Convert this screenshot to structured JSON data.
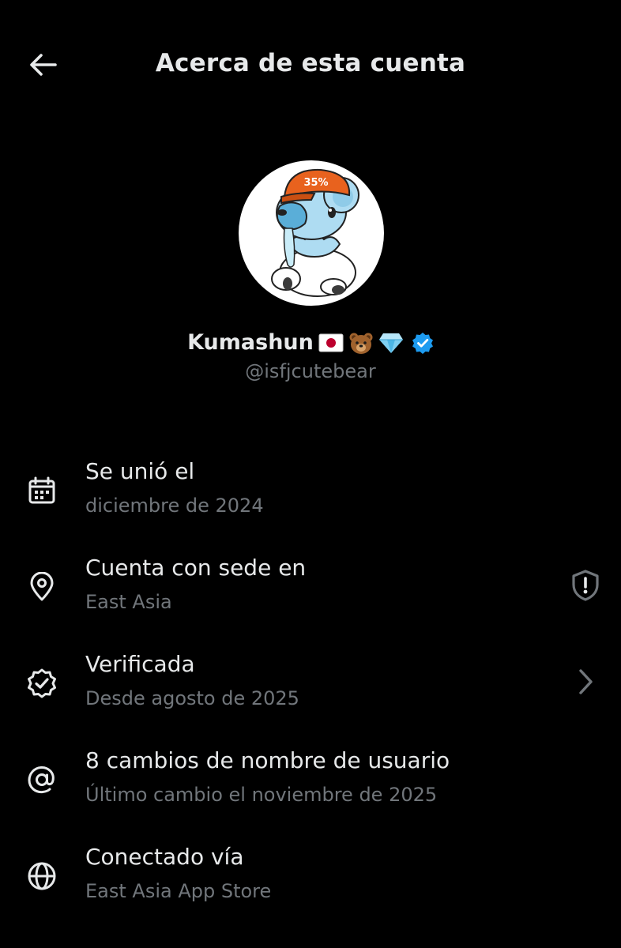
{
  "header": {
    "title": "Acerca de esta cuenta",
    "back_icon": "arrow-left-icon"
  },
  "profile": {
    "display_name": "Kumashun",
    "name_emojis": [
      "🇯🇵",
      "🐻",
      "💎"
    ],
    "handle": "@isfjcutebear",
    "verified": true,
    "avatar_cap_text": "35%",
    "colors": {
      "verified_badge": "#1d9bf0",
      "text_primary": "#e7e9ea",
      "text_secondary": "#71767b",
      "background": "#000000"
    }
  },
  "info": [
    {
      "icon": "calendar-icon",
      "title": "Se unió el",
      "subtitle": "diciembre de 2024",
      "trailing": null
    },
    {
      "icon": "location-pin-icon",
      "title": "Cuenta con sede en",
      "subtitle": "East Asia",
      "trailing": "shield-alert-icon"
    },
    {
      "icon": "verified-badge-icon",
      "title": "Verificada",
      "subtitle": "Desde agosto de 2025",
      "trailing": "chevron-right-icon"
    },
    {
      "icon": "at-sign-icon",
      "title": "8 cambios de nombre de usuario",
      "subtitle": "Último cambio el noviembre de 2025",
      "trailing": null
    },
    {
      "icon": "globe-icon",
      "title": "Conectado vía",
      "subtitle": "East Asia App Store",
      "trailing": null
    }
  ]
}
